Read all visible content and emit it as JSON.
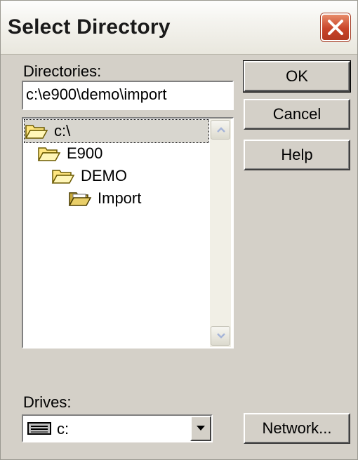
{
  "window": {
    "title": "Select Directory"
  },
  "labels": {
    "directories": "Directories:",
    "drives": "Drives:"
  },
  "path_field": {
    "value": "c:\\e900\\demo\\import"
  },
  "directory_tree": [
    {
      "label": "c:\\",
      "selected": true,
      "icon": "open-folder-icon"
    },
    {
      "label": "E900",
      "selected": false,
      "icon": "open-folder-icon"
    },
    {
      "label": "DEMO",
      "selected": false,
      "icon": "open-folder-icon"
    },
    {
      "label": "Import",
      "selected": false,
      "icon": "open-folder-filled-icon"
    }
  ],
  "buttons": {
    "ok": "OK",
    "cancel": "Cancel",
    "help": "Help",
    "network": "Network..."
  },
  "drive_select": {
    "value": "c:",
    "icon": "drive-icon"
  },
  "colors": {
    "window_bg": "#d4d0c8",
    "close_red": "#c9452a",
    "folder_yellow": "#ffe680"
  }
}
